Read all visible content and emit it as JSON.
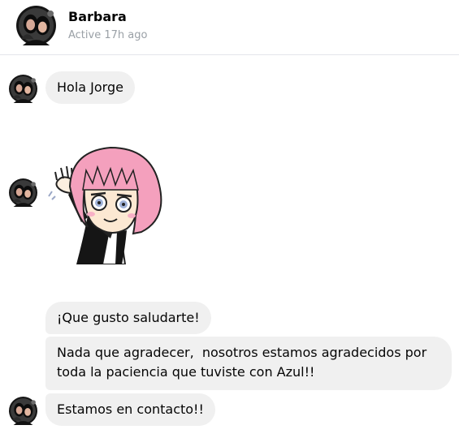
{
  "contact": {
    "name": "Barbara",
    "status": "Active 17h ago"
  },
  "messages": [
    {
      "text": "Hola Jorge"
    },
    {
      "sticker": "girl-pink-hair-waving-sticker"
    },
    {
      "text": "¡Que gusto saludarte!"
    },
    {
      "text": "Nada que agradecer,  nosotros estamos agradecidos por\ntoda la paciencia que tuviste con Azul!!"
    },
    {
      "text": "Estamos en contacto!!"
    }
  ],
  "colors": {
    "bubble": "#f0f0f0",
    "status_text": "#9aa0a6",
    "sticker_hair": "#f4a0bd"
  }
}
